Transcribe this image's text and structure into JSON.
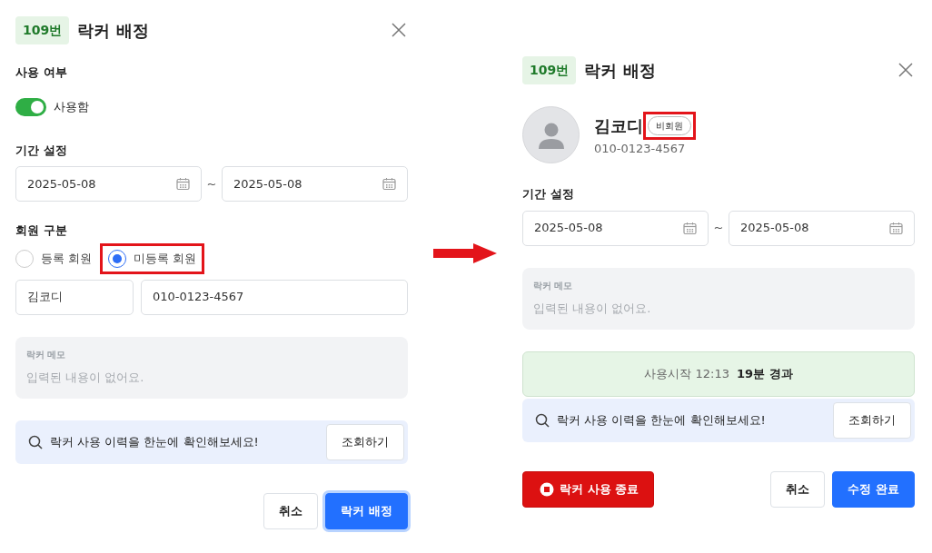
{
  "before": {
    "badge": "109번",
    "title": "락커 배정",
    "usage": {
      "label": "사용 여부",
      "toggle_label": "사용함",
      "on": true
    },
    "period": {
      "label": "기간 설정",
      "start": "2025-05-08",
      "separator": "~",
      "end": "2025-05-08"
    },
    "member_type": {
      "label": "회원 구분",
      "options": [
        {
          "label": "등록 회원",
          "selected": false,
          "highlighted": false
        },
        {
          "label": "미등록 회원",
          "selected": true,
          "highlighted": true
        }
      ]
    },
    "name_field": {
      "value": "김코디"
    },
    "phone_field": {
      "value": "010-0123-4567"
    },
    "memo": {
      "label": "락커 메모",
      "text": "입력된 내용이 없어요."
    },
    "history": {
      "text": "락커 사용 이력을 한눈에 확인해보세요!",
      "button": "조회하기"
    },
    "buttons": [
      {
        "label": "취소",
        "kind": "secondary",
        "focused": false
      },
      {
        "label": "락커 배정",
        "kind": "primary",
        "focused": true
      }
    ]
  },
  "after": {
    "badge": "109번",
    "title": "락커 배정",
    "member": {
      "name": "김코디",
      "tag": "비회원",
      "tag_highlighted": true,
      "phone": "010-0123-4567"
    },
    "period": {
      "label": "기간 설정",
      "start": "2025-05-08",
      "separator": "~",
      "end": "2025-05-08"
    },
    "memo": {
      "label": "락커 메모",
      "text": "입력된 내용이 없어요."
    },
    "status": {
      "started": "사용시작 12:13",
      "elapsed": "19분 경과"
    },
    "history": {
      "text": "락커 사용 이력을 한눈에 확인해보세요!",
      "button": "조회하기"
    },
    "end_button": "락커 사용 종료",
    "buttons": [
      {
        "label": "취소",
        "kind": "secondary",
        "focused": false
      },
      {
        "label": "수정 완료",
        "kind": "primary",
        "focused": false
      }
    ]
  }
}
